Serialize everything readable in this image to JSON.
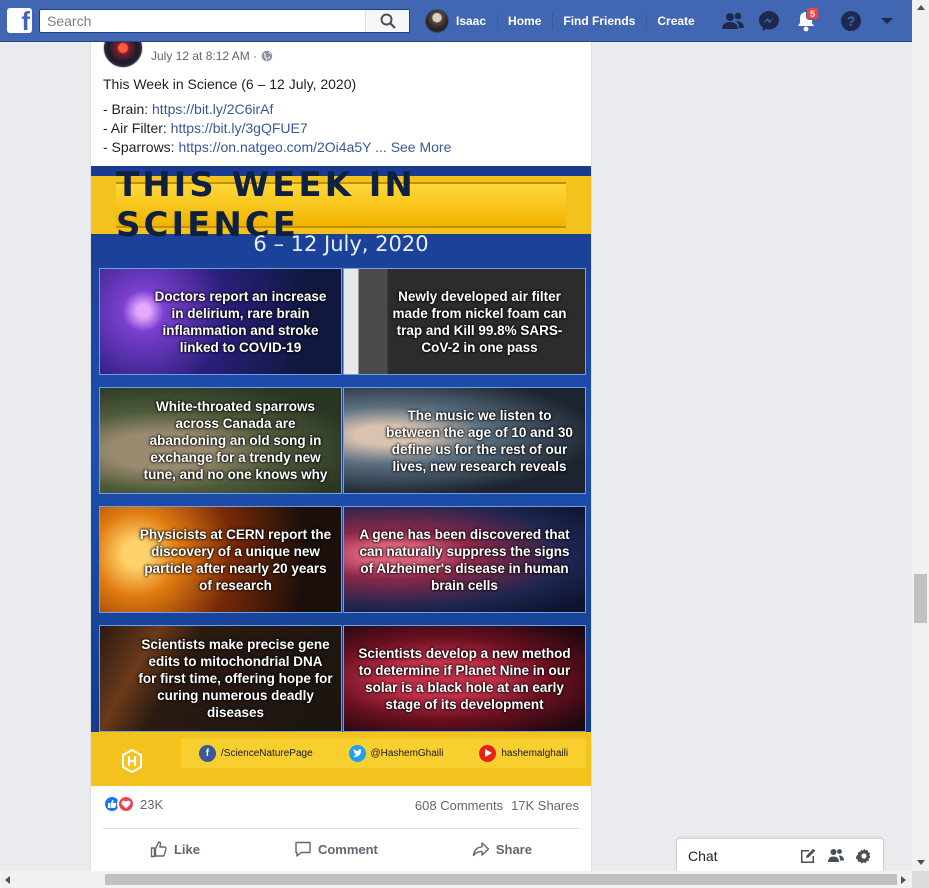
{
  "topbar": {
    "search_placeholder": "Search",
    "user_name": "Isaac",
    "nav": [
      "Home",
      "Find Friends",
      "Create"
    ],
    "notifications_count": "5",
    "brand_color": "#4267b2"
  },
  "post": {
    "timestamp": "July 12 at 8:12 AM · ",
    "headline": "This Week in Science (6 – 12 July, 2020)",
    "lines": [
      {
        "label": "- Brain: ",
        "link": "https://bit.ly/2C6irAf"
      },
      {
        "label": "- Air Filter: ",
        "link": "https://bit.ly/3gQFUE7"
      },
      {
        "label": "- Sparrows: ",
        "link": "https://on.natgeo.com/2Oi4a5Y"
      }
    ],
    "ellipsis": " ... ",
    "see_more": "See More",
    "link_color": "#385898"
  },
  "graphic": {
    "title": "THIS WEEK IN SCIENCE",
    "date": "6 – 12 July, 2020",
    "tiles": [
      "Doctors report an increase in delirium, rare brain inflammation and stroke linked to COVID-19",
      "Newly developed air filter made from nickel foam can trap and Kill 99.8% SARS-CoV-2 in one pass",
      "White-throated sparrows across Canada are abandoning an old song in exchange for a trendy new tune, and no one knows why",
      "The music we listen to between the age of 10 and 30 define us for the rest of our lives, new research reveals",
      "Physicists at CERN report the discovery of a unique new particle after nearly 20 years of research",
      "A gene has been discovered that can naturally suppress the signs of Alzheimer's disease in human brain cells",
      "Scientists make precise gene edits to mitochondrial DNA for first time, offering hope for curing numerous deadly diseases",
      "Scientists develop a new method to determine if Planet Nine in our solar is a black hole at an early stage of its development"
    ],
    "social": {
      "facebook": "/ScienceNaturePage",
      "twitter": "@HashemGhaili",
      "youtube": "hashemalghaili"
    }
  },
  "engagement": {
    "reactions": "23K",
    "comments": "608 Comments",
    "shares": "17K Shares"
  },
  "actions": {
    "like": "Like",
    "comment": "Comment",
    "share": "Share"
  },
  "chat": {
    "label": "Chat"
  }
}
